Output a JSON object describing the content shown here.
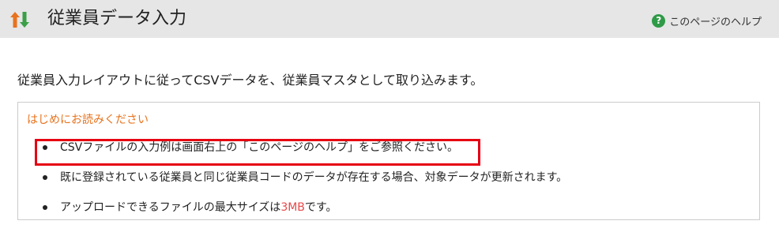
{
  "header": {
    "title": "従業員データ入力",
    "icon": "sort-arrows-icon",
    "help_label": "このページのヘルプ",
    "help_icon_glyph": "?"
  },
  "intro_text": "従業員入力レイアウトに従ってCSVデータを、従業員マスタとして取り込みます。",
  "notice": {
    "title": "はじめにお読みください",
    "items": [
      {
        "text": "CSVファイルの入力例は画面右上の「このページのヘルプ」をご参照ください。"
      },
      {
        "text": "既に登録されている従業員と同じ従業員コードのデータが存在する場合、対象データが更新されます。"
      },
      {
        "text_before": "アップロードできるファイルの最大サイズは",
        "text_accent": "3MB",
        "text_after": "です。"
      }
    ]
  },
  "colors": {
    "header_bg": "#e6e6e6",
    "notice_title": "#e8731e",
    "accent": "#e84848",
    "highlight_border": "#e60012",
    "help_icon_bg": "#2f9a47",
    "arrow_up": "#e8731e",
    "arrow_down": "#3aa047"
  }
}
